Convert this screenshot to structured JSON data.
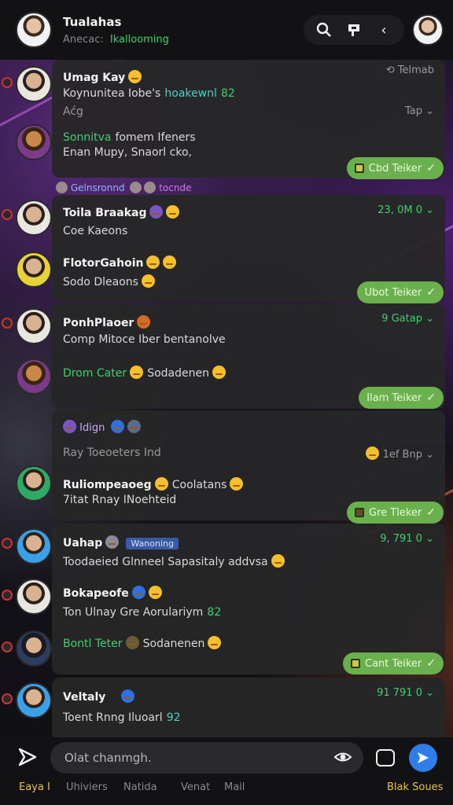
{
  "header": {
    "title": "Tualahas",
    "subtitle_prefix": "Anecac:",
    "subtitle_green": "Ikallooming",
    "icons": [
      "search-icon",
      "flag-icon",
      "back-chevron-icon"
    ]
  },
  "feed": [
    {
      "id": "a",
      "top_row_name": "Umag Kay",
      "time": "Telmab",
      "line1": "Koynunitea Iobe's",
      "line1_teal": "hoakewnl",
      "line1_green": "82",
      "meta_left": "Aćg",
      "meta_right": "Tap",
      "sub_name_green": "Sonnitva",
      "sub_name_rest": "fomem Ifeners",
      "sub_text": "Enan Mupy, Snaorl cko,",
      "button": "Cbd Teiker"
    },
    {
      "id": "b",
      "banner": "Gelnsronnd",
      "banner_tag": "tocnde",
      "name1": "Toila Braakag",
      "time": "23, 0M 0",
      "text1": "Coe Kaeons",
      "name2": "FlotorGahoin",
      "text2": "Sodo Dleaons",
      "button": "Ubot Teiker"
    },
    {
      "id": "c",
      "name1": "PonhPlaoer",
      "time": "9 Gatap",
      "text1": "Comp Mitoce Iber bentanolve",
      "name2_green": "Drom Cater",
      "name2_rest": "Sodadenen",
      "button": "Ilam Teiker"
    },
    {
      "id": "d",
      "top_chip": "Idign",
      "text1": "Ray Toeoeters Ind",
      "meta": "1ef Bnp",
      "name2": "Ruliompeaoeg",
      "name2_rest": "Coolatans",
      "text2": "7itat Rnay INoehteid",
      "button": "Gre Tleker"
    },
    {
      "id": "e",
      "name1": "Uahap",
      "tag": "Wanoning",
      "time": "9, 791 0",
      "text1": "Toodaeied Glnneel Sapasitaly addvsa",
      "name2": "Bokapeofe",
      "text2": "Ton Ulnay Gre Aorulariym",
      "text2_green": "82",
      "name3_green": "Bontl Teter",
      "name3_rest": "Sodanenen",
      "button": "Cant Teiker"
    },
    {
      "id": "f",
      "name1": "Veltaly",
      "time": "91 791 0",
      "text1": "Toent Rnng Iluoarl",
      "text1_teal": "92"
    }
  ],
  "composer": {
    "placeholder": "Olat chanmgh.",
    "tabs": [
      "Eaya I",
      "Uhiviers",
      "Natida",
      "Venat",
      "Mail",
      "Blak Soues"
    ]
  }
}
